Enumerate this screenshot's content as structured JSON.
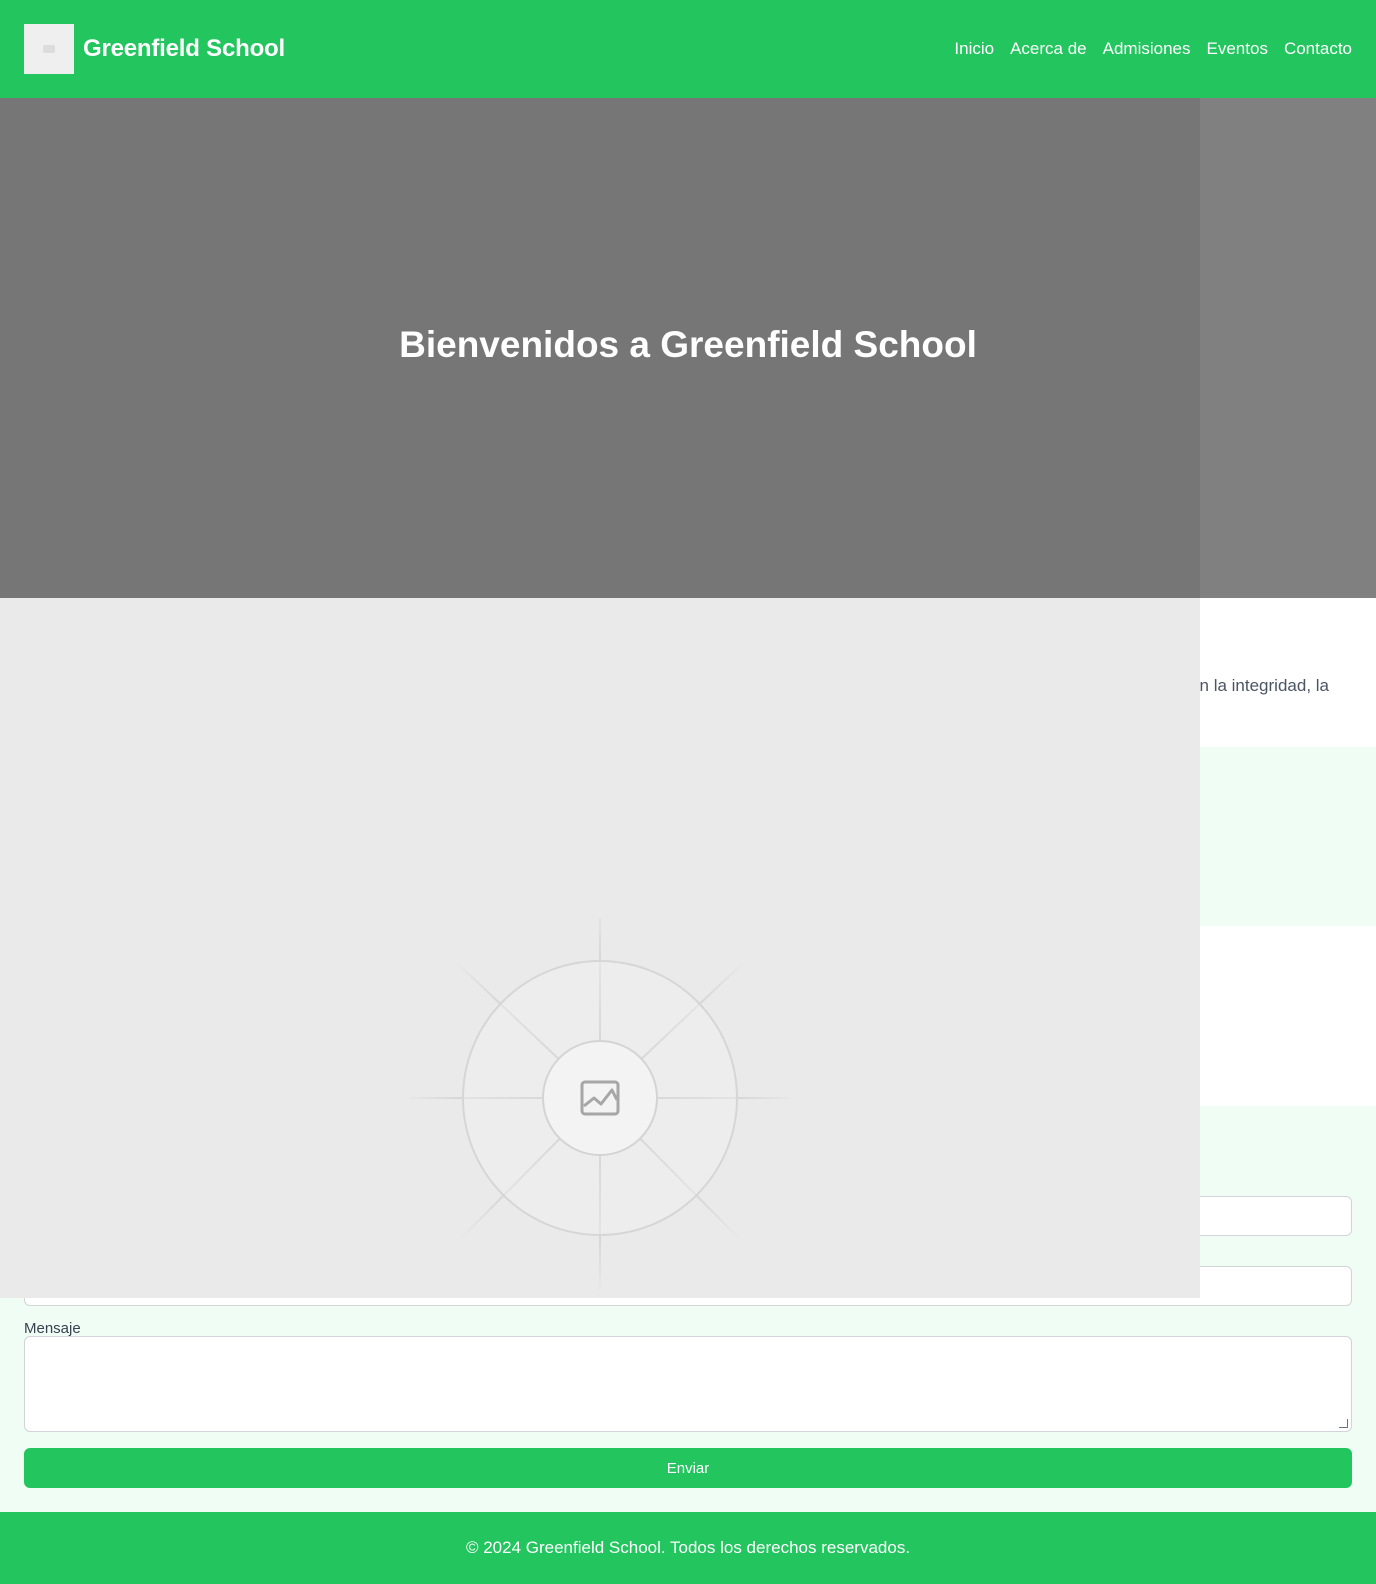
{
  "header": {
    "school_name": "Greenfield School",
    "nav": [
      "Inicio",
      "Acerca de",
      "Admisiones",
      "Eventos",
      "Contacto"
    ]
  },
  "hero": {
    "title": "Bienvenidos a Greenfield School"
  },
  "about": {
    "partial_text": "n la integridad, la"
  },
  "contact": {
    "message_label": "Mensaje",
    "submit_label": "Enviar"
  },
  "footer": {
    "copyright": "© 2024 Greenfield School. Todos los derechos reservados."
  },
  "colors": {
    "brand_green": "#22c55e",
    "light_green_bg": "#f0fdf4",
    "hero_gray": "#808080",
    "placeholder_gray": "#eaeaea"
  },
  "icons": {
    "logo": "school-logo-icon",
    "placeholder": "image-placeholder-icon"
  }
}
